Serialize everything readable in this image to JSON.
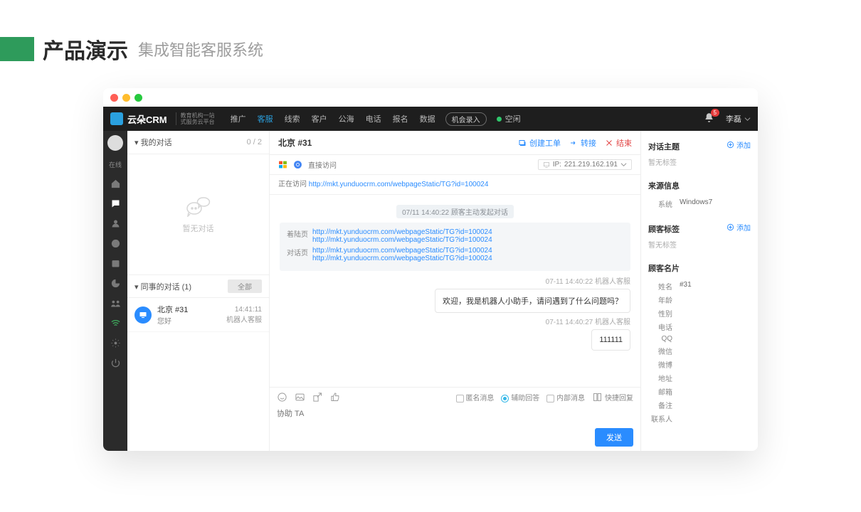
{
  "slide": {
    "title": "产品演示",
    "subtitle": "集成智能客服系统"
  },
  "nav": {
    "brand": "云朵CRM",
    "brand_sub1": "教育机构一站",
    "brand_sub2": "式服务云平台",
    "items": [
      "推广",
      "客服",
      "线索",
      "客户",
      "公海",
      "电话",
      "报名",
      "数据"
    ],
    "active": "客服",
    "record_btn": "机会录入",
    "idle": "空闲",
    "badge": "5",
    "user": "李磊"
  },
  "rail": {
    "status": "在线"
  },
  "left": {
    "my_header": "我的对话",
    "my_count": "0 / 2",
    "empty": "暂无对话",
    "collab_header": "同事的对话  (1)",
    "filter_all": "全部",
    "item": {
      "name": "北京 #31",
      "preview": "您好",
      "time": "14:41:11",
      "role": "机器人客服"
    }
  },
  "centre": {
    "title": "北京 #31",
    "actions": {
      "ticket": "创建工单",
      "transfer": "转接",
      "end": "结束"
    },
    "access": "直接访问",
    "visiting_label": "正在访问",
    "visiting_url": "http://mkt.yunduocrm.com/webpageStatic/TG?id=100024",
    "ip_label": "IP:",
    "ip": "221.219.162.191",
    "chip": "07/11 14:40:22  顾客主动发起对话",
    "ref": {
      "landing_label": "着陆页",
      "landing": [
        "http://mkt.yunduocrm.com/webpageStatic/TG?id=100024",
        "http://mkt.yunduocrm.com/webpageStatic/TG?id=100024"
      ],
      "dialog_label": "对话页",
      "dialog": [
        "http://mkt.yunduocrm.com/webpageStatic/TG?id=100024",
        "http://mkt.yunduocrm.com/webpageStatic/TG?id=100024"
      ]
    },
    "m1": {
      "meta": "07-11 14:40:22  机器人客服",
      "text": "欢迎，我是机器人小助手，请问遇到了什么问题吗？"
    },
    "m2": {
      "meta": "07-11 14:40:27  机器人客服",
      "text": "111111"
    },
    "compose": {
      "anon": "匿名消息",
      "assist": "辅助回答",
      "internal": "内部消息",
      "quick": "快捷回复",
      "placeholder": "协助 TA",
      "send": "发送"
    }
  },
  "right": {
    "topic": "对话主题",
    "add": "添加",
    "no_tag": "暂无标签",
    "source": "来源信息",
    "sys_label": "系统",
    "sys_value": "Windows7",
    "tags": "顾客标签",
    "card": "顾客名片",
    "kv": [
      {
        "k": "姓名",
        "v": "#31"
      },
      {
        "k": "年龄",
        "v": ""
      },
      {
        "k": "性别",
        "v": ""
      },
      {
        "k": "电话",
        "v": ""
      },
      {
        "k": "QQ",
        "v": ""
      },
      {
        "k": "微信",
        "v": ""
      },
      {
        "k": "微博",
        "v": ""
      },
      {
        "k": "地址",
        "v": ""
      },
      {
        "k": "邮箱",
        "v": ""
      },
      {
        "k": "备注",
        "v": ""
      },
      {
        "k": "联系人",
        "v": ""
      }
    ]
  }
}
